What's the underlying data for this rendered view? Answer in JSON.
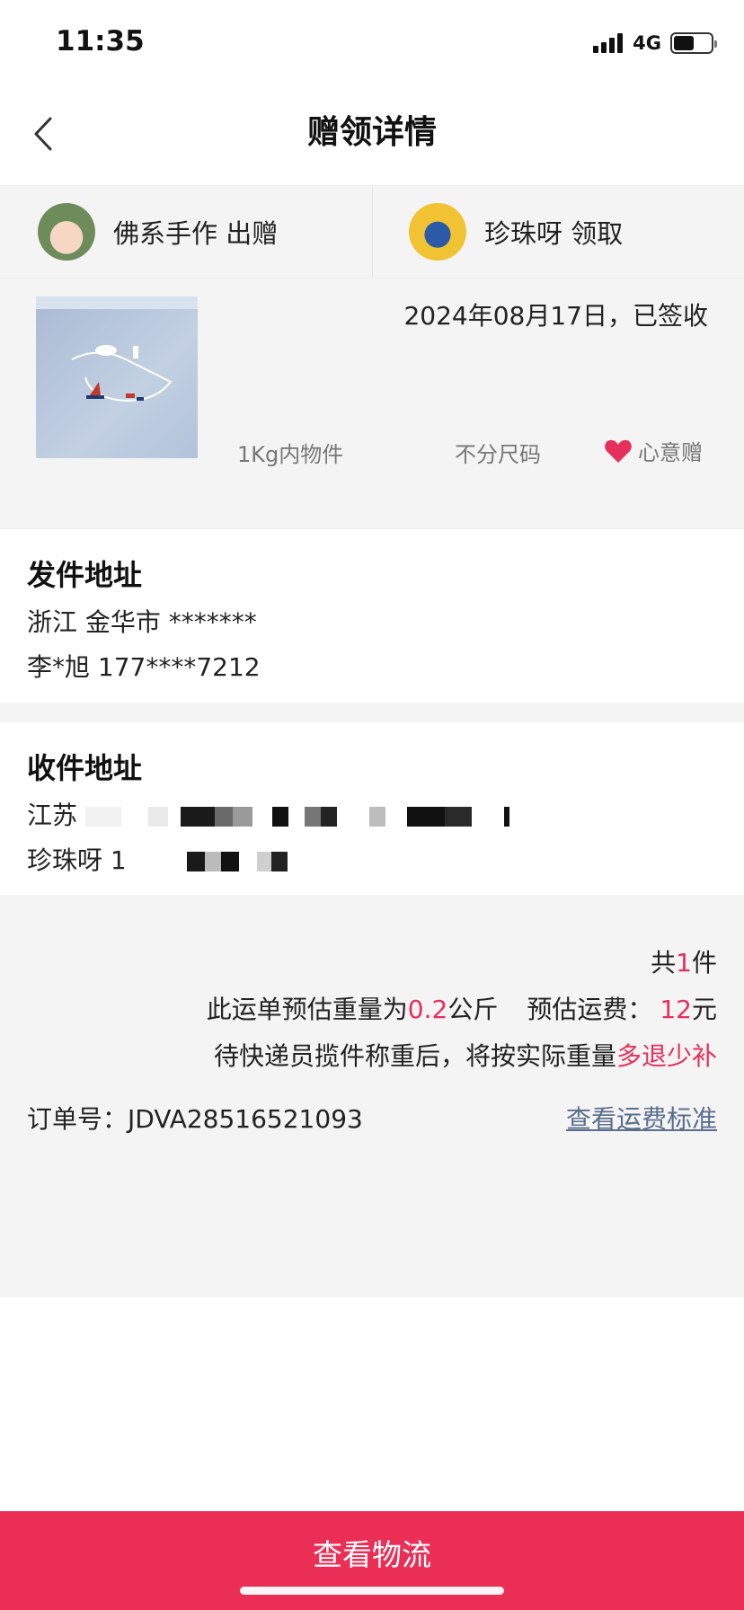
{
  "status_bar": {
    "time": "11:35",
    "network": "4G"
  },
  "nav": {
    "title": "赠领详情",
    "back_icon": "chevron-left-icon"
  },
  "giver": {
    "name_action": "佛系手作 出赠"
  },
  "receiver": {
    "name_action": "珍珠呀 领取"
  },
  "item": {
    "date_status": "2024年08月17日，已签收",
    "weight_tag": "1Kg内物件",
    "size_tag": "不分尺码",
    "gift_tag": "心意赠",
    "gift_icon": "heart-icon"
  },
  "sender_address": {
    "title": "发件地址",
    "line1": "浙江 金华市 *******",
    "line2": "李*旭 177****7212"
  },
  "receiver_address": {
    "title": "收件地址",
    "line1_prefix": "江苏",
    "line2_prefix": "珍珠呀 1"
  },
  "summary": {
    "count_prefix": "共",
    "count_value": "1",
    "count_suffix": "件",
    "weight_prefix": "此运单预估重量为",
    "weight_value": "0.2",
    "weight_unit": "公斤",
    "fee_label": "预估运费：",
    "fee_value": "12",
    "fee_unit": "元",
    "note_prefix": "待快递员揽件称重后，将按实际重量",
    "note_highlight": "多退少补",
    "order_label": "订单号：",
    "order_number": "JDVA28516521093",
    "fee_standard_link": "查看运费标准"
  },
  "bottom_button": {
    "label": "查看物流"
  },
  "colors": {
    "accent": "#ea2e55",
    "highlight": "#e5305c",
    "link": "#5a6f8e",
    "section_bg": "#f4f4f4"
  }
}
